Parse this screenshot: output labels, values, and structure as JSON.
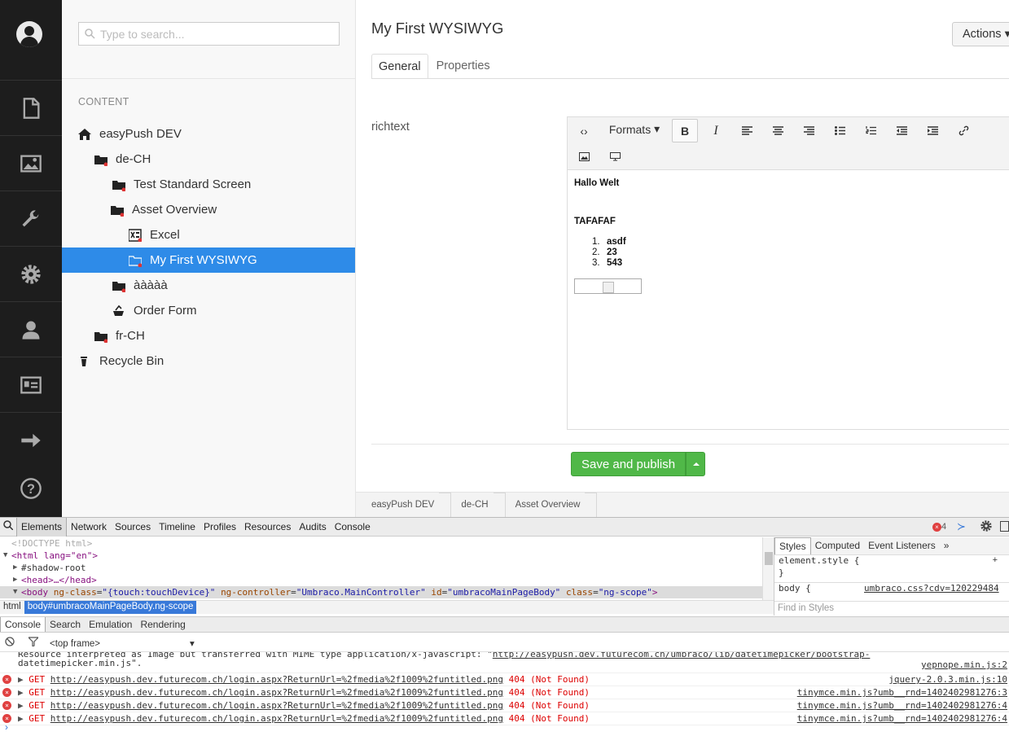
{
  "sidebar_nav": {
    "items": [
      {
        "name": "content-icon"
      },
      {
        "name": "media-icon"
      },
      {
        "name": "developer-icon"
      },
      {
        "name": "settings-icon"
      },
      {
        "name": "users-icon"
      },
      {
        "name": "members-icon"
      },
      {
        "name": "forms-icon"
      },
      {
        "name": "help-icon"
      }
    ]
  },
  "tree": {
    "search_placeholder": "Type to search...",
    "section_title": "CONTENT",
    "nodes": [
      {
        "label": "easyPush DEV",
        "icon": "home-icon"
      },
      {
        "label": "de-CH",
        "icon": "folder-icon"
      },
      {
        "label": "Test Standard Screen",
        "icon": "folder-icon"
      },
      {
        "label": "Asset Overview",
        "icon": "folder-icon"
      },
      {
        "label": "Excel",
        "icon": "excel-icon"
      },
      {
        "label": "My First WYSIWYG",
        "icon": "folder-icon",
        "selected": true
      },
      {
        "label": "ààààà",
        "icon": "folder-icon"
      },
      {
        "label": "Order Form",
        "icon": "form-icon"
      },
      {
        "label": "fr-CH",
        "icon": "folder-icon"
      },
      {
        "label": "Recycle Bin",
        "icon": "trash-icon"
      }
    ]
  },
  "main": {
    "title": "My First WYSIWYG",
    "actions_label": "Actions",
    "tabs": [
      {
        "label": "General"
      },
      {
        "label": "Properties"
      }
    ],
    "property_label": "richtext",
    "editor": {
      "formats_label": "Formats",
      "content_line1": "Hallo Welt",
      "content_line2": "TAFAFAF",
      "list": [
        "asdf",
        "23",
        "543"
      ]
    },
    "save_label": "Save and publish",
    "breadcrumb": [
      "easyPush DEV",
      "de-CH",
      "Asset Overview"
    ]
  },
  "devtools": {
    "tabs": [
      "Elements",
      "Network",
      "Sources",
      "Timeline",
      "Profiles",
      "Resources",
      "Audits",
      "Console"
    ],
    "error_count": "4",
    "code_lines": {
      "doctype": "<!DOCTYPE html>",
      "html_open": "<html lang=\"en\">",
      "shadow": "#shadow-root",
      "head": "<head>…</head>",
      "body_tag": "<body",
      "body_attr1": "ng-class",
      "body_val1": "\"{touch:touchDevice}\"",
      "body_attr2": "ng-controller",
      "body_val2": "\"Umbraco.MainController\"",
      "body_attr3": "id",
      "body_val3": "\"umbracoMainPageBody\"",
      "body_attr4": "class",
      "body_val4": "\"ng-scope\""
    },
    "crumbs": [
      "html",
      "body#umbracoMainPageBody.ng-scope"
    ],
    "styles_tabs": [
      "Styles",
      "Computed",
      "Event Listeners"
    ],
    "styles_line1": "element.style {",
    "styles_line2": "}",
    "styles_line3": "body {",
    "styles_link": "umbraco.css?cdv=120229484",
    "find_styles": "Find in Styles",
    "drawer_tabs": [
      "Console",
      "Search",
      "Emulation",
      "Rendering"
    ],
    "frame_label": "<top frame>",
    "warn_text": "Resource interpreted as Image but transferred with MIME type application/x-javascript: \"",
    "warn_url": "http://easypush.dev.futurecom.ch/umbraco/lib/datetimepicker/bootstrap-",
    "warn_src": "yepnope.min.js:2",
    "warn_line2": "datetimepicker.min.js\".",
    "errors": [
      {
        "method": "GET",
        "url": "http://easypush.dev.futurecom.ch/login.aspx?ReturnUrl=%2fmedia%2f1009%2funtitled.png",
        "status": "404 (Not Found)",
        "src": "jquery-2.0.3.min.js:10"
      },
      {
        "method": "GET",
        "url": "http://easypush.dev.futurecom.ch/login.aspx?ReturnUrl=%2fmedia%2f1009%2funtitled.png",
        "status": "404 (Not Found)",
        "src": "tinymce.min.js?umb__rnd=1402402981276:3"
      },
      {
        "method": "GET",
        "url": "http://easypush.dev.futurecom.ch/login.aspx?ReturnUrl=%2fmedia%2f1009%2funtitled.png",
        "status": "404 (Not Found)",
        "src": "tinymce.min.js?umb__rnd=1402402981276:4"
      },
      {
        "method": "GET",
        "url": "http://easypush.dev.futurecom.ch/login.aspx?ReturnUrl=%2fmedia%2f1009%2funtitled.png",
        "status": "404 (Not Found)",
        "src": "tinymce.min.js?umb__rnd=1402402981276:4"
      }
    ]
  },
  "colors": {
    "selected": "#2e8be8",
    "save": "#50b848",
    "nav_bg": "#1d1d1d"
  }
}
